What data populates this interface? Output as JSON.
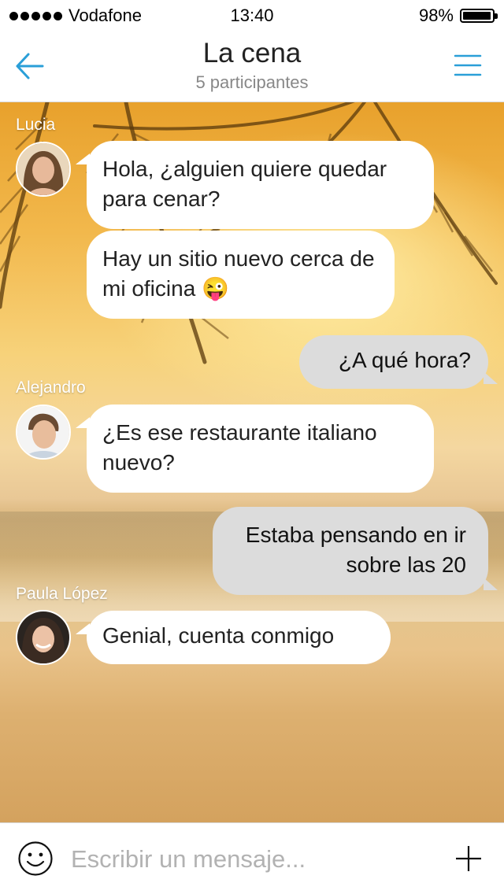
{
  "status_bar": {
    "carrier": "Vodafone",
    "time": "13:40",
    "battery": "98%",
    "battery_level": 0.98
  },
  "header": {
    "title": "La cena",
    "subtitle": "5 participantes",
    "back_icon": "arrow-left-icon",
    "menu_icon": "hamburger-menu-icon",
    "accent_color": "#2a9fd8"
  },
  "messages": [
    {
      "sender": "Lucia",
      "text": "Hola, ¿alguien quiere quedar para cenar?",
      "direction": "incoming"
    },
    {
      "text": "Hay un sitio nuevo cerca de mi oficina",
      "emoji": "😜",
      "direction": "incoming"
    },
    {
      "text": "¿A qué hora?",
      "direction": "outgoing"
    },
    {
      "sender": "Alejandro",
      "text": "¿Es ese restaurante italiano nuevo?",
      "direction": "incoming"
    },
    {
      "text": "Estaba pensando en ir sobre las 20",
      "direction": "outgoing"
    },
    {
      "sender": "Paula López",
      "text": "Genial, cuenta conmigo",
      "direction": "incoming"
    }
  ],
  "composer": {
    "placeholder": "Escribir un mensaje...",
    "emoji_icon": "smiley-face-icon",
    "add_icon": "plus-icon"
  },
  "colors": {
    "incoming_bubble": "#ffffff",
    "outgoing_bubble": "#dcdcdc",
    "placeholder": "#b2b2b2"
  }
}
